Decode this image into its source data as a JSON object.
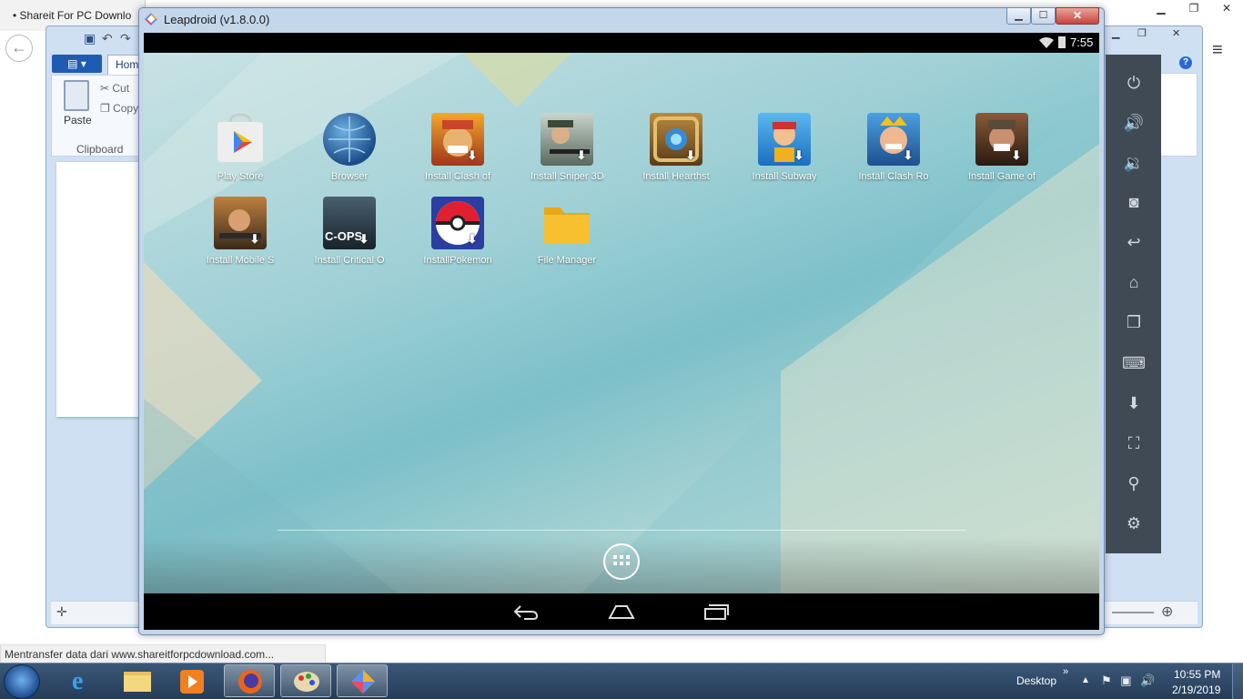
{
  "browser": {
    "tab_title": "Shareit For PC Downlo",
    "back_icon": "arrow-left-icon",
    "status_text": "Mentransfer data dari www.shareitforpcdownload.com..."
  },
  "paint": {
    "file_menu": "▤ ▾",
    "home_tab": "Hom",
    "paste_label": "Paste",
    "cut_label": "Cut",
    "copy_label": "Copy",
    "clipboard_group": "Clipboard"
  },
  "leapdroid": {
    "title": "Leapdroid (v1.8.0.0)",
    "status_time": "7:55",
    "apps": [
      {
        "label": "Play Store",
        "icon": "play-store-icon"
      },
      {
        "label": "Browser",
        "icon": "browser-globe-icon"
      },
      {
        "label": "Install Clash of",
        "icon": "clash-of-clans-icon"
      },
      {
        "label": "Install Sniper 3D",
        "icon": "sniper-3d-icon"
      },
      {
        "label": "Install Hearthst",
        "icon": "hearthstone-icon"
      },
      {
        "label": "Install Subway",
        "icon": "subway-surfers-icon"
      },
      {
        "label": "Install Clash Ro",
        "icon": "clash-royale-icon"
      },
      {
        "label": "Install Game of",
        "icon": "game-of-war-icon"
      },
      {
        "label": "Install Mobile S",
        "icon": "mobile-strike-icon"
      },
      {
        "label": "Install Critical O",
        "icon": "critical-ops-icon"
      },
      {
        "label": "InstallPokemon",
        "icon": "pokeball-icon"
      },
      {
        "label": "File Manager",
        "icon": "folder-icon"
      }
    ],
    "critical_ops_text": "C-OPS",
    "toolbar": [
      "power-icon",
      "volume-up-icon",
      "volume-down-icon",
      "camera-icon",
      "back-arrow-icon",
      "home-icon",
      "recent-apps-icon",
      "keyboard-icon",
      "download-icon",
      "fullscreen-icon",
      "location-icon",
      "settings-gear-icon"
    ]
  },
  "taskbar": {
    "desktop_label": "Desktop",
    "time": "10:55 PM",
    "date": "2/19/2019",
    "buttons": [
      "windows-start-icon",
      "internet-explorer-icon",
      "file-explorer-icon",
      "media-player-icon",
      "firefox-icon",
      "paint-icon",
      "leapdroid-icon"
    ]
  },
  "colors": {
    "taskbar": "#2f4a6b",
    "toolbar": "#3f4a55",
    "leap_close": "#c8443a"
  }
}
